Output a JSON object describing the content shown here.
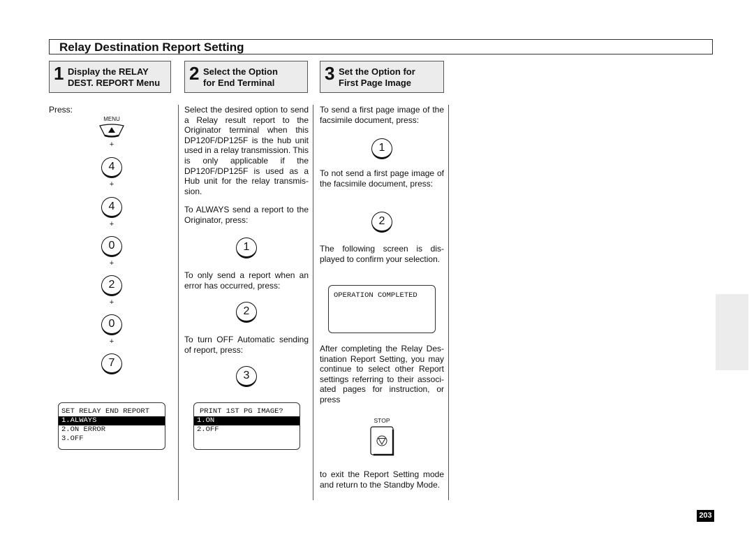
{
  "title": "Relay Destination Report Setting",
  "steps": [
    {
      "number": "1",
      "label_line1": "Display the RELAY",
      "label_line2": "DEST. REPORT Menu"
    },
    {
      "number": "2",
      "label_line1": "Select the Option",
      "label_line2": "for End Terminal"
    },
    {
      "number": "3",
      "label_line1": "Set the Option for",
      "label_line2": "First Page Image"
    }
  ],
  "col1": {
    "press_label": "Press:",
    "menu_key": {
      "label": "MENU",
      "icon": "up-triangle-icon",
      "glyph": "▲"
    },
    "plus": "+",
    "keys": [
      "4",
      "4",
      "0",
      "2",
      "0",
      "7"
    ],
    "lcd": {
      "rows": [
        "SET RELAY END REPORT",
        "1.ALWAYS",
        "2.ON ERROR",
        "3.OFF"
      ],
      "selected_index": 1
    }
  },
  "col2": {
    "intro": "Select the desired option to send a Relay result report to the Originator terminal when this DP120F/DP125F is the hub unit used in a relay transmission. This is only applicable if the DP120F/DP125F is used as a Hub unit for the relay transmis-sion.",
    "always_text": "To ALWAYS send a report to the Originator, press:",
    "always_key": "1",
    "error_text": "To only send a report when an error has occurred, press:",
    "error_key": "2",
    "off_text": "To turn OFF Automatic sending of report, press:",
    "off_key": "3",
    "lcd": {
      "rows": [
        "PRINT 1ST PG IMAGE?",
        "1.ON",
        "2.OFF"
      ],
      "selected_index": 1
    }
  },
  "col3": {
    "send_text": "To send a first page image of the facsimile document, press:",
    "send_key": "1",
    "nosend_text": "To not send a first page image of the facsimile document, press:",
    "nosend_key": "2",
    "confirm_text": "The following screen is dis-played to confirm your selection.",
    "lcd": {
      "rows": [
        "OPERATION COMPLETED"
      ]
    },
    "after_text": "After completing the Relay Des-tination Report Setting, you may continue to select other Report settings referring to their associ-ated pages for instruction, or press",
    "stop_key": {
      "label": "STOP",
      "icon": "stop-icon"
    },
    "exit_text": "to exit the Report Setting mode and return to the Standby Mode."
  },
  "page_number": "203"
}
